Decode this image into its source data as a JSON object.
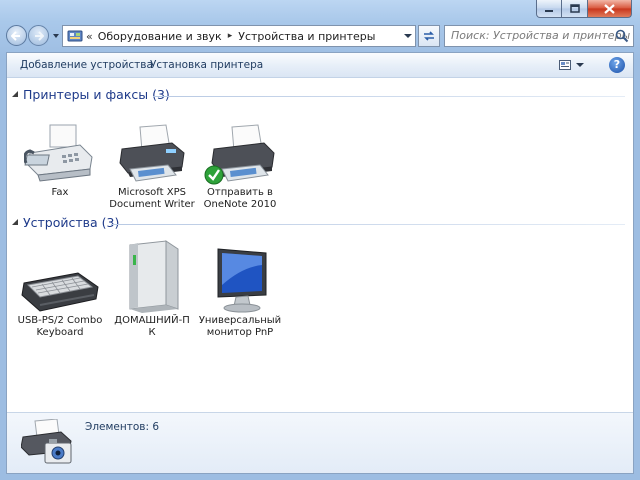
{
  "window": {
    "caption_buttons": [
      "minimize",
      "maximize",
      "close"
    ]
  },
  "address_bar": {
    "overflow": "«",
    "crumbs": [
      "Оборудование и звук",
      "Устройства и принтеры"
    ],
    "separator": "▸"
  },
  "search": {
    "placeholder": "Поиск: Устройства и принтеры"
  },
  "toolbar": {
    "add_device": "Добавление устройства",
    "add_printer": "Установка принтера",
    "help": "?"
  },
  "groups": [
    {
      "title": "Принтеры и факсы (3)",
      "items": [
        {
          "label": [
            "Fax"
          ],
          "icon": "fax-icon"
        },
        {
          "label": [
            "Microsoft XPS",
            "Document Writer"
          ],
          "icon": "printer-icon"
        },
        {
          "label": [
            "Отправить в",
            "OneNote 2010"
          ],
          "icon": "printer-default-icon",
          "default": true
        }
      ]
    },
    {
      "title": "Устройства (3)",
      "items": [
        {
          "label": [
            "USB-PS/2 Combo",
            "Keyboard"
          ],
          "icon": "keyboard-icon"
        },
        {
          "label": [
            "ДОМАШНИЙ-П",
            "К"
          ],
          "icon": "computer-tower-icon"
        },
        {
          "label": [
            "Универсальный",
            "монитор PnP"
          ],
          "icon": "monitor-icon"
        }
      ]
    }
  ],
  "details": {
    "count_text": "Элементов: 6"
  },
  "colors": {
    "group_title": "#1e3a8a",
    "accent": "#1a4fa8",
    "check": "#2ea23a"
  }
}
